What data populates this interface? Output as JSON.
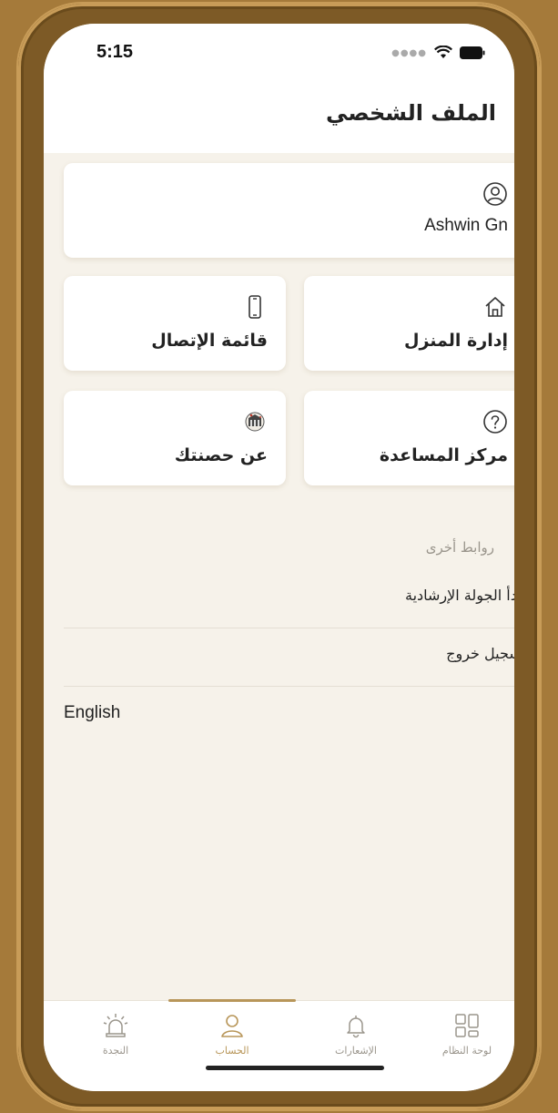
{
  "status_bar": {
    "time": "5:15",
    "icons": [
      "signal-dots-icon",
      "wifi-icon",
      "battery-icon"
    ]
  },
  "header": {
    "title": "الملف الشخصي"
  },
  "profile": {
    "icon": "user-circle-icon",
    "name": "Ashwin Gn"
  },
  "cards": {
    "home_management": {
      "label": "إدارة المنزل",
      "icon": "home-icon"
    },
    "contacts_list": {
      "label": "قائمة الإتصال",
      "icon": "phone-icon"
    },
    "help_center": {
      "label": "مركز المساعدة",
      "icon": "question-circle-icon"
    },
    "about": {
      "label": "عن حصنتك",
      "icon": "logo-icon"
    }
  },
  "other_links": {
    "title": "روابط أخرى",
    "items": [
      {
        "label": "ابدأ الجولة الإرشادية"
      },
      {
        "label": "تسجيل خروج"
      }
    ]
  },
  "language_toggle": "English",
  "tabbar": {
    "tabs": [
      {
        "label": "النجدة",
        "icon": "alarm-siren-icon",
        "active": false
      },
      {
        "label": "الحساب",
        "icon": "user-icon",
        "active": true
      },
      {
        "label": "الإشعارات",
        "icon": "bell-icon",
        "active": false
      },
      {
        "label": "لوحة النظام",
        "icon": "dashboard-grid-icon",
        "active": false
      }
    ]
  },
  "colors": {
    "accent": "#b89659",
    "background": "#f6f2ea",
    "card": "#ffffff",
    "text": "#222222",
    "muted": "#9a958c"
  }
}
